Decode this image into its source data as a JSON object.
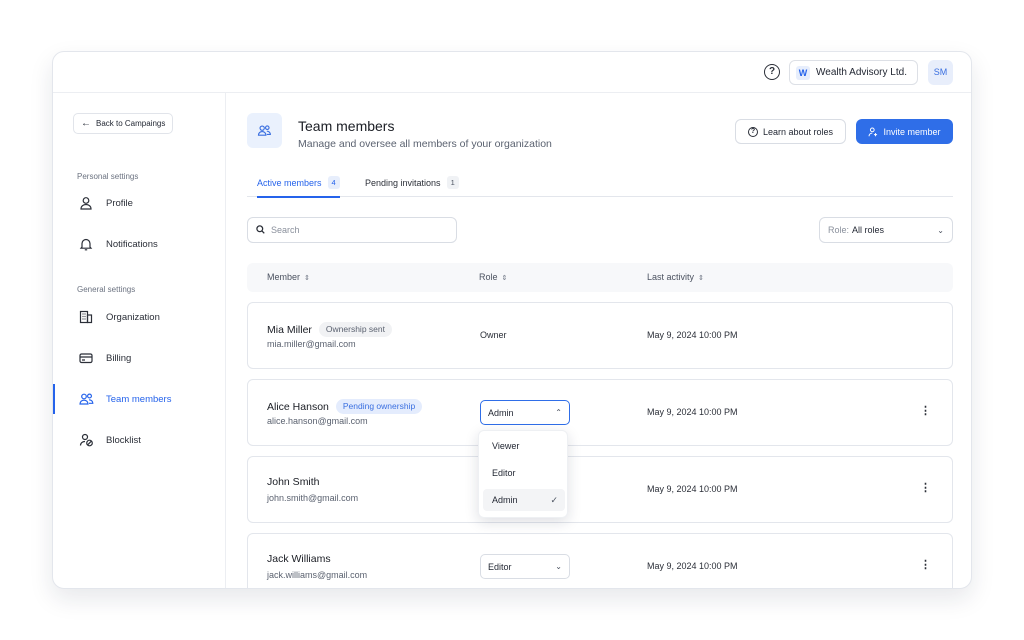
{
  "topbar": {
    "help_icon": "question-circle-icon",
    "org_logo_letter": "W",
    "org_name": "Wealth Advisory Ltd.",
    "user_initials": "SM"
  },
  "sidebar": {
    "back_label": "Back to Campaings",
    "personal_section": "Personal settings",
    "general_section": "General settings",
    "items": [
      {
        "label": "Profile",
        "icon": "user-icon"
      },
      {
        "label": "Notifications",
        "icon": "bell-icon"
      },
      {
        "label": "Organization",
        "icon": "building-icon"
      },
      {
        "label": "Billing",
        "icon": "credit-card-icon"
      },
      {
        "label": "Team members",
        "icon": "users-icon",
        "active": true
      },
      {
        "label": "Blocklist",
        "icon": "user-blocked-icon"
      }
    ]
  },
  "header": {
    "title": "Team members",
    "subtitle": "Manage and oversee all members of your organization",
    "learn_label": "Learn about roles",
    "invite_label": "Invite member"
  },
  "tabs": [
    {
      "label": "Active members",
      "count": "4"
    },
    {
      "label": "Pending invitations",
      "count": "1"
    }
  ],
  "search": {
    "placeholder": "Search"
  },
  "role_filter": {
    "label": "Role:",
    "value": "All roles"
  },
  "table": {
    "headers": [
      "Member",
      "Role",
      "Last activity"
    ],
    "rows": [
      {
        "name": "Mia Miller",
        "badge": "Ownership sent",
        "email": "mia.miller@gmail.com",
        "role": "Owner",
        "last_activity": "May 9, 2024 10:00 PM"
      },
      {
        "name": "Alice Hanson",
        "badge": "Pending ownership",
        "email": "alice.hanson@gmail.com",
        "role": "Admin",
        "last_activity": "May 9, 2024 10:00 PM"
      },
      {
        "name": "John Smith",
        "badge": "",
        "email": "john.smith@gmail.com",
        "role": "Admin",
        "last_activity": "May 9, 2024 10:00 PM"
      },
      {
        "name": "Jack Williams",
        "badge": "",
        "email": "jack.williams@gmail.com",
        "role": "Editor",
        "last_activity": "May 9, 2024 10:00 PM"
      }
    ]
  },
  "role_dropdown": {
    "options": [
      "Viewer",
      "Editor",
      "Admin"
    ],
    "selected": "Admin"
  },
  "colors": {
    "accent": "#2f6ee8",
    "badge_blue_bg": "#e4ecfd"
  }
}
